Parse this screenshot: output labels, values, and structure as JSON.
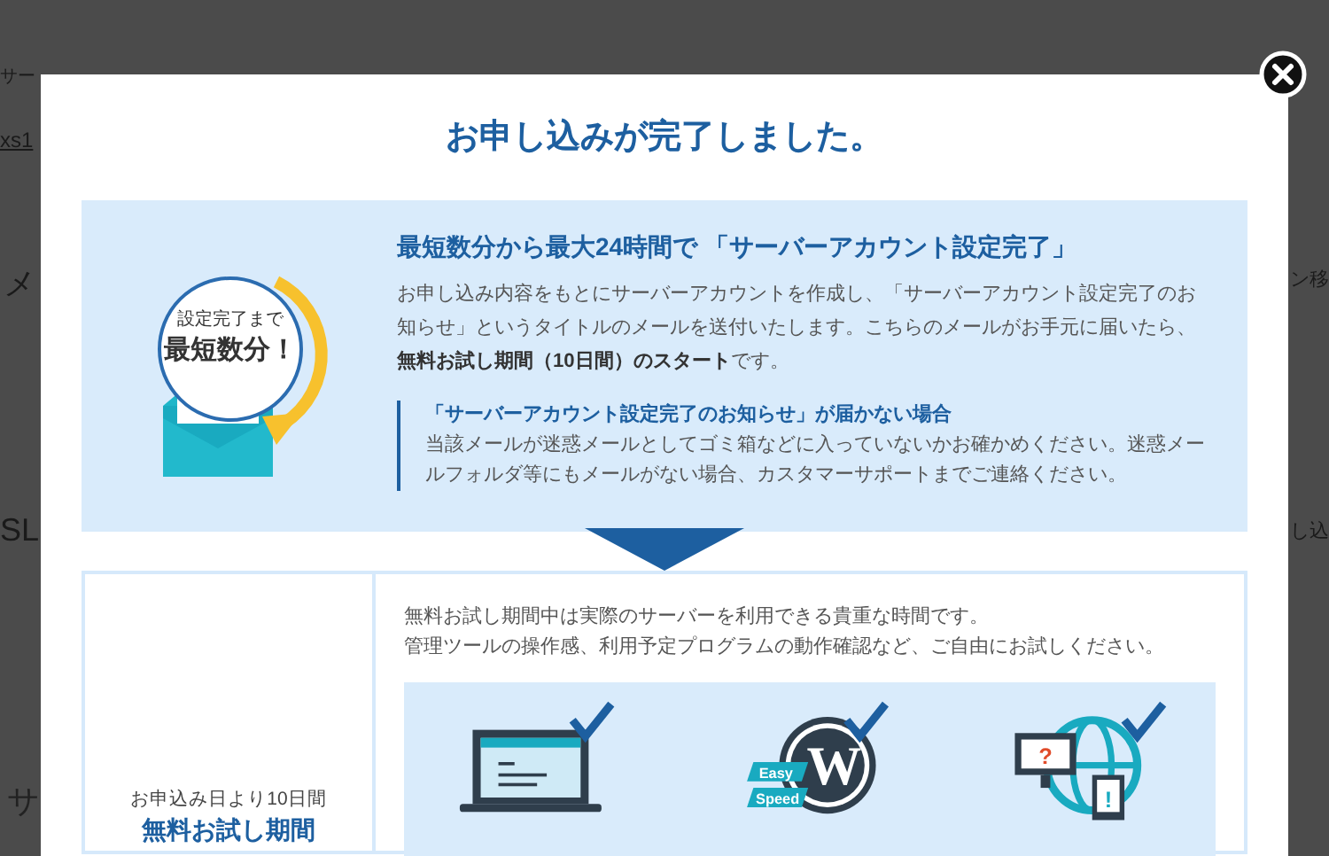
{
  "background": {
    "left_fragments": [
      "サー",
      "xs1",
      "メ",
      "SL",
      "サ"
    ],
    "right_fragments": [
      "ン移",
      "し込"
    ]
  },
  "dialog": {
    "title": "お申し込みが完了しました。",
    "info": {
      "badge_small": "設定完了まで",
      "badge_large": "最短数分！",
      "heading": "最短数分から最大24時間で 「サーバーアカウント設定完了」",
      "paragraph": "お申し込み内容をもとにサーバーアカウントを作成し、「サーバーアカウント設定完了のお知らせ」というタイトルのメールを送付いたします。こちらのメールがお手元に届いたら、**無料お試し期間（10日間）のスタート**です。",
      "note": {
        "title": "「サーバーアカウント設定完了のお知らせ」が届かない場合",
        "body": "当該メールが迷惑メールとしてゴミ箱などに入っていないかお確かめください。迷惑メールフォルダ等にもメールがない場合、カスタマーサポートまでご連絡ください。"
      }
    },
    "trial": {
      "caption": "お申込み日より10日間",
      "title": "無料お試し期間",
      "intro_lines": [
        "無料お試し期間中は実際のサーバーを利用できる貴重な時間です。",
        "管理ツールの操作感、利用予定プログラムの動作確認など、ご自由にお試しください。"
      ],
      "features": [
        {
          "kind": "laptop"
        },
        {
          "kind": "wordpress",
          "letter": "W",
          "labels": [
            "Easy",
            "Speed"
          ]
        },
        {
          "kind": "globe",
          "marks": [
            "?",
            "!"
          ]
        }
      ]
    }
  }
}
